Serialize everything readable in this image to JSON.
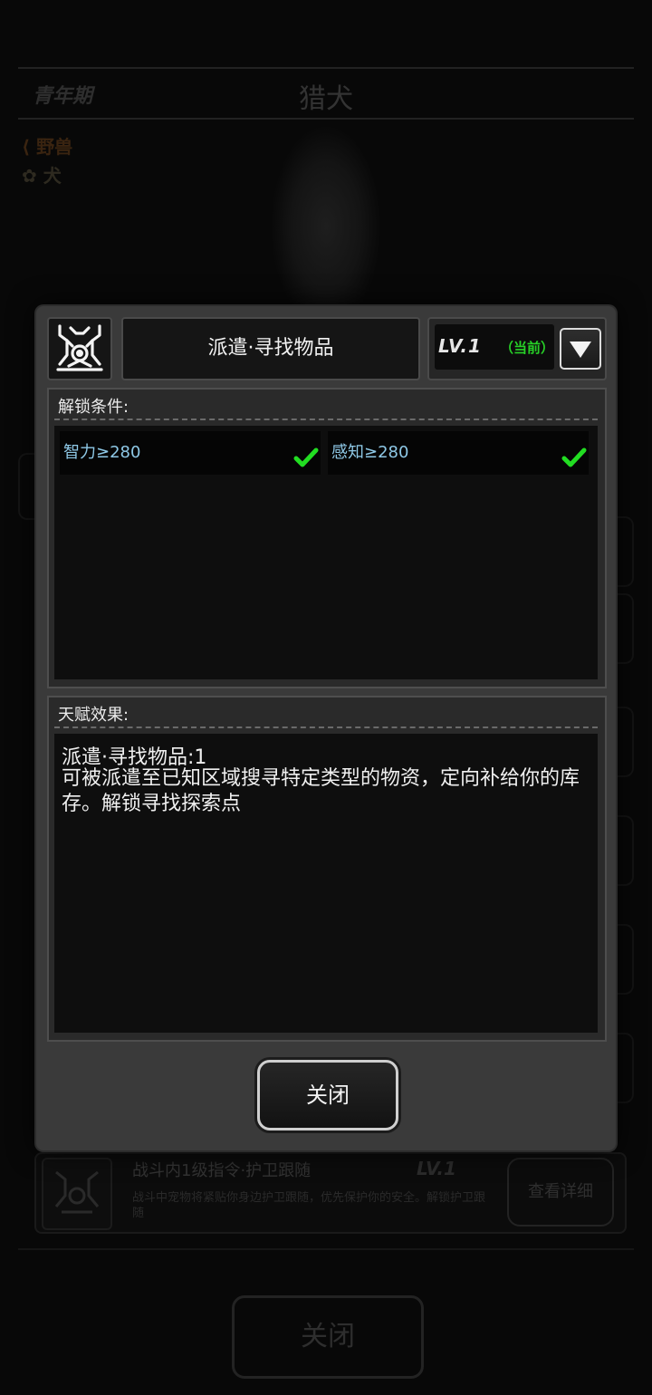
{
  "background": {
    "stage": "青年期",
    "pet_name": "猎犬",
    "tags": [
      "野兽",
      "犬"
    ],
    "skill_card": {
      "title": "战斗内1级指令·护卫跟随",
      "level": "LV.1",
      "desc": "战斗中宠物将紧贴你身边护卫跟随，优先保护你的安全。解锁护卫跟随",
      "detail_button": "查看详细"
    },
    "close_button": "关闭"
  },
  "modal": {
    "talent_icon": "dog-emblem-icon",
    "title": "派遣·寻找物品",
    "level": "LV.1",
    "current_tag": "（当前）",
    "unlock": {
      "label": "解锁条件:",
      "conditions": [
        {
          "text": "智力≥280",
          "met": true
        },
        {
          "text": "感知≥280",
          "met": true
        }
      ]
    },
    "effect": {
      "label": "天赋效果:",
      "heading": "派遣·寻找物品:1",
      "description": "可被派遣至已知区域搜寻特定类型的物资，定向补给你的库存。解锁寻找探索点"
    },
    "close_button": "关闭"
  },
  "colors": {
    "condition_text": "#8ec8e6",
    "check_mark": "#22dd22",
    "current_tag": "#27d027"
  }
}
